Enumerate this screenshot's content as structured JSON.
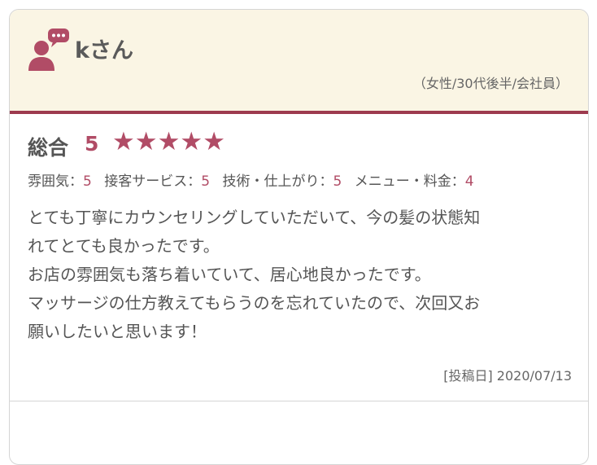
{
  "review": {
    "user_name": "kさん",
    "user_meta": "（女性/30代後半/会社員）",
    "total_label": "総合",
    "total_score": "5",
    "stars": [
      "★",
      "★",
      "★",
      "★",
      "★"
    ],
    "sub_ratings": [
      {
        "label": "雰囲気：",
        "value": "5"
      },
      {
        "label": "接客サービス：",
        "value": "5"
      },
      {
        "label": "技術・仕上がり：",
        "value": "5"
      },
      {
        "label": "メニュー・料金：",
        "value": "4"
      }
    ],
    "text_lines": [
      "とても丁寧にカウンセリングしていただいて、今の髪の状態知",
      "れてとても良かったです。",
      "お店の雰囲気も落ち着いていて、居心地良かったです。",
      "マッサージの仕方教えてもらうのを忘れていたので、次回又お",
      "願いしたいと思います！"
    ],
    "post_date": "[投稿日] 2020/07/13"
  },
  "colors": {
    "accent": "#b14c66",
    "header_bg": "#faf5e4",
    "header_border": "#9d3a4e"
  },
  "icons": {
    "avatar": "user-comment-icon",
    "star": "star-icon"
  }
}
